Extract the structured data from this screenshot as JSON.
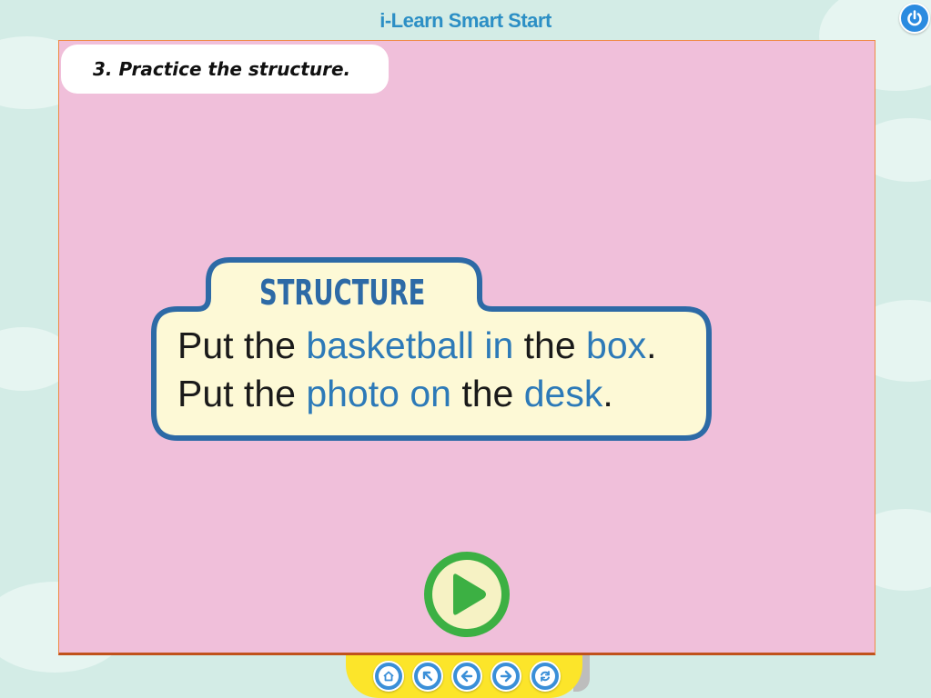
{
  "app": {
    "title": "i-Learn Smart Start"
  },
  "slide": {
    "instruction": "3. Practice the structure.",
    "structure": {
      "heading": "STRUCTURE",
      "sentence1": {
        "p1": "Put the ",
        "h1": "basketball in",
        "p2": " the ",
        "h2": "box",
        "p3": "."
      },
      "sentence2": {
        "p1": "Put the ",
        "h1": "photo on",
        "p2": " the ",
        "h2": "desk",
        "p3": "."
      }
    }
  },
  "controls": {
    "play_icon": "play-icon",
    "nav_icons": [
      "home-icon",
      "back-to-start-icon",
      "previous-icon",
      "next-icon",
      "replay-icon"
    ]
  },
  "colors": {
    "background": "#d3ece6",
    "slide": "#f0bfda",
    "structure_fill": "#fdf9d6",
    "structure_border": "#2d6aa6",
    "highlight_text": "#2d7ab8",
    "play_button": "#3cb043",
    "nav_bar": "#fce52a",
    "nav_button": "#3a8fd8"
  }
}
